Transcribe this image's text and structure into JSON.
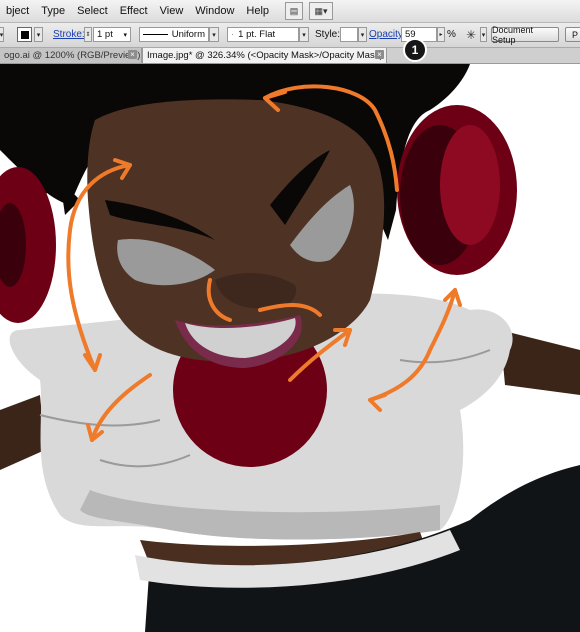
{
  "menu": {
    "items": [
      "bject",
      "Type",
      "Select",
      "Effect",
      "View",
      "Window",
      "Help"
    ]
  },
  "controlbar": {
    "stroke_label": "Stroke:",
    "stroke_weight": "1 pt",
    "profile_label": "Uniform",
    "brush_label": "1 pt. Flat",
    "style_label": "Style:",
    "opacity_label": "Opacity:",
    "opacity_value": "59",
    "percent_sign": "%",
    "document_setup_label": "Document Setup",
    "cut_off_button_label": "P"
  },
  "tabs": [
    {
      "label": "ogo.ai @ 1200% (RGB/Preview)",
      "active": false
    },
    {
      "label": "Image.jpg* @ 326.34% (<Opacity Mask>/Opacity Mask)",
      "active": true
    }
  ],
  "callout": {
    "number": "1"
  },
  "colors": {
    "skin": "#4e3224",
    "hair": "#0a0707",
    "headphone_red": "#6e0016",
    "shirt": "#d9d9d9",
    "pants": "#111417",
    "guide_orange": "#ef7a2a"
  }
}
